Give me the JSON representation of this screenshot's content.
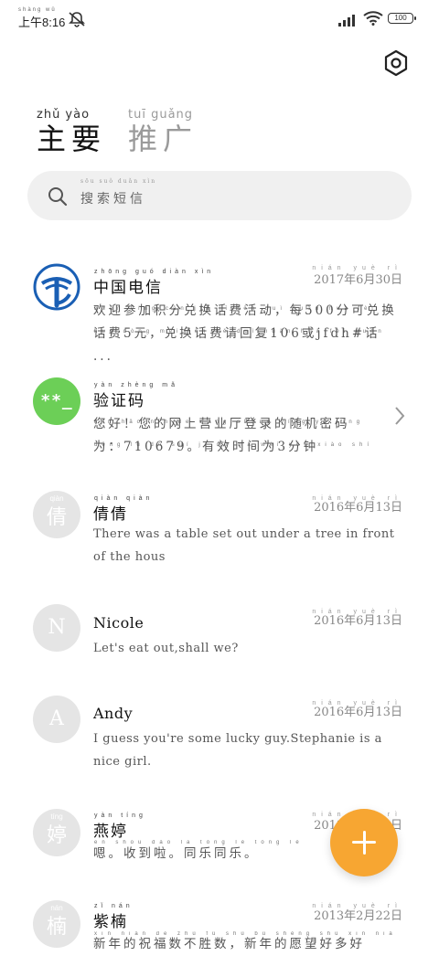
{
  "status_bar": {
    "time_pinyin": "shàng wǔ",
    "time": "上午8:16",
    "battery": "100",
    "icons": [
      "mute-icon",
      "signal-icon",
      "wifi-icon",
      "battery-icon"
    ]
  },
  "header": {
    "settings_icon": "settings-icon",
    "tabs": [
      {
        "pinyin": "zhǔ  yào",
        "label": "主要",
        "active": true
      },
      {
        "pinyin": "tuī  guǎng",
        "label": "推广",
        "active": false
      }
    ]
  },
  "search": {
    "pinyin": "sōu  suǒ  duǎn  xìn",
    "placeholder": "搜索短信"
  },
  "messages": [
    {
      "sender_pinyin": "zhōng guó diàn xìn",
      "sender": "中国电信",
      "avatar": "china-telecom-logo",
      "date_pinyin": "nián yuè rì",
      "date": "2017年6月30日",
      "preview_pinyin": "huān yíng cān jiā jī fēn duì huàn huà fèi huó dòng měi fēn kě duì huàn huà fèi yuán duì huàn huà fèi qǐng huí fù huò huà",
      "preview": "欢迎参加积分兑换话费活动，每500分可兑换话费5元，兑换话费请回复106或jfdh#话 ..."
    },
    {
      "sender_pinyin": "yàn zhèng mǎ",
      "sender": "验证码",
      "avatar_text": "**_",
      "preview_pinyin": "nín hǎo nín de wǎng shàng yíng yè tīng dēng lù de suí jī mì mǎ wéi yǒu xiào shí jiān wéi fēn zhōng",
      "preview": "您好！您的网上营业厅登录的随机密码为：710679。有效时间为3分钟"
    },
    {
      "sender_pinyin": "qiàn qiàn",
      "sender": "倩倩",
      "avatar_pinyin": "qiàn",
      "avatar_text": "倩",
      "date_pinyin": "nián yuè rì",
      "date": "2016年6月13日",
      "preview": "There was a table set out under a tree in front of the hous"
    },
    {
      "sender": "Nicole",
      "avatar_text": "N",
      "date_pinyin": "nián yuè rì",
      "date": "2016年6月13日",
      "preview": "Let's eat out,shall we?"
    },
    {
      "sender": "Andy",
      "avatar_text": "A",
      "date_pinyin": "nián yuè rì",
      "date": "2016年6月13日",
      "preview": "I guess you're some lucky guy.Stephanie is a nice girl."
    },
    {
      "sender_pinyin": "yàn tíng",
      "sender": "燕婷",
      "avatar_pinyin": "tíng",
      "avatar_text": "婷",
      "date_pinyin": "nián yuè rì",
      "date": "2013年2月22日",
      "preview_pinyin": "en shōu dào lā tóng lè tóng lè",
      "preview": "嗯。收到啦。同乐同乐。"
    },
    {
      "sender_pinyin": "zǐ nán",
      "sender": "紫楠",
      "avatar_pinyin": "nán",
      "avatar_text": "楠",
      "date_pinyin": "nián yuè rì",
      "date": "2013年2月22日",
      "preview_pinyin": "xīn nián de zhù fú shù bù shèng shù xīn nián de yuàn wàng hǎo duō hǎo",
      "preview": "新年的祝福数不胜数，新年的愿望好多好"
    }
  ],
  "fab": {
    "icon": "plus-icon"
  }
}
